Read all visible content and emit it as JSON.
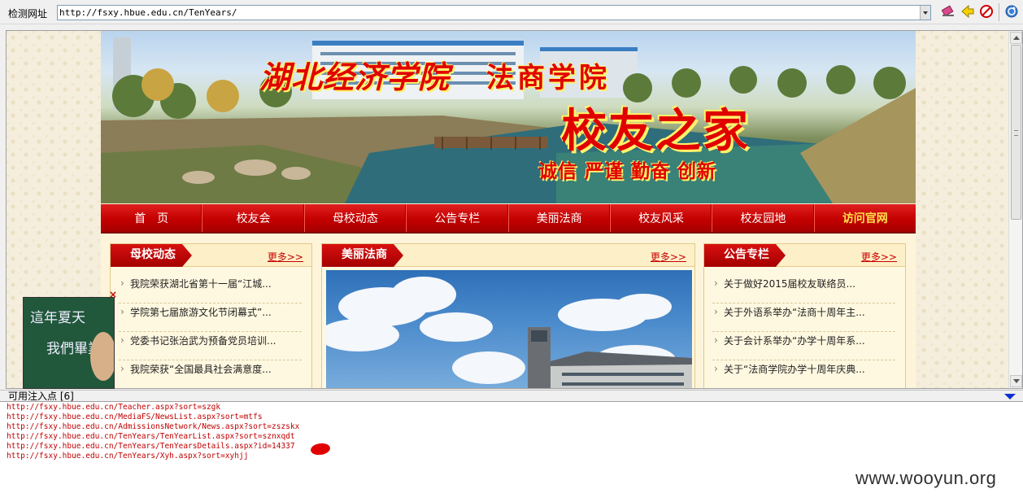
{
  "toolbar": {
    "address_label": "检测网址",
    "address_value": "http://fsxy.hbue.edu.cn/TenYears/",
    "icons": [
      "eraser-icon",
      "back-arrow-icon",
      "stop-icon",
      "refresh-icon"
    ]
  },
  "site": {
    "banner": {
      "school_name": "湖北经济学院",
      "college_name": "法商学院",
      "home_title": "校友之家",
      "slogan": "诚信 严谨 勤奋 创新"
    },
    "nav": [
      {
        "label": "首　页"
      },
      {
        "label": "校友会"
      },
      {
        "label": "母校动态"
      },
      {
        "label": "公告专栏"
      },
      {
        "label": "美丽法商"
      },
      {
        "label": "校友风采"
      },
      {
        "label": "校友园地"
      },
      {
        "label": "访问官网"
      }
    ],
    "panels": {
      "left": {
        "title": "母校动态",
        "more": "更多>>",
        "items": [
          "我院荣获湖北省第十一届“江城...",
          "学院第七届旅游文化节闭幕式”...",
          "党委书记张治武为预备党员培训...",
          "我院荣获“全国最具社会满意度..."
        ]
      },
      "middle": {
        "title": "美丽法商",
        "more": "更多>>"
      },
      "right": {
        "title": "公告专栏",
        "more": "更多>>",
        "items": [
          "关于做好2015届校友联络员...",
          "关于外语系举办“法商十周年主...",
          "关于会计系举办“办学十周年系...",
          "关于“法商学院办学十周年庆典..."
        ]
      }
    },
    "float_ad": {
      "line1": "這年夏天",
      "line2": "我們畢業",
      "close": "×"
    }
  },
  "injection": {
    "label": "可用注入点 [6]",
    "urls": [
      "http://fsxy.hbue.edu.cn/Teacher.aspx?sort=szgk",
      "http://fsxy.hbue.edu.cn/MediaFS/NewsList.aspx?sort=mtfs",
      "http://fsxy.hbue.edu.cn/AdmissionsNetwork/News.aspx?sort=zszskx",
      "http://fsxy.hbue.edu.cn/TenYears/TenYearList.aspx?sort=sznxqdt",
      "http://fsxy.hbue.edu.cn/TenYears/TenYearsDetails.aspx?id=14337",
      "http://fsxy.hbue.edu.cn/TenYears/Xyh.aspx?sort=xyhjj"
    ]
  },
  "watermark": "www.wooyun.org",
  "colors": {
    "nav_red": "#c40000",
    "nav_highlight": "#ffe14a",
    "banner_text": "#e00000",
    "url_text": "#c00000",
    "page_bg": "#f5eedc"
  }
}
